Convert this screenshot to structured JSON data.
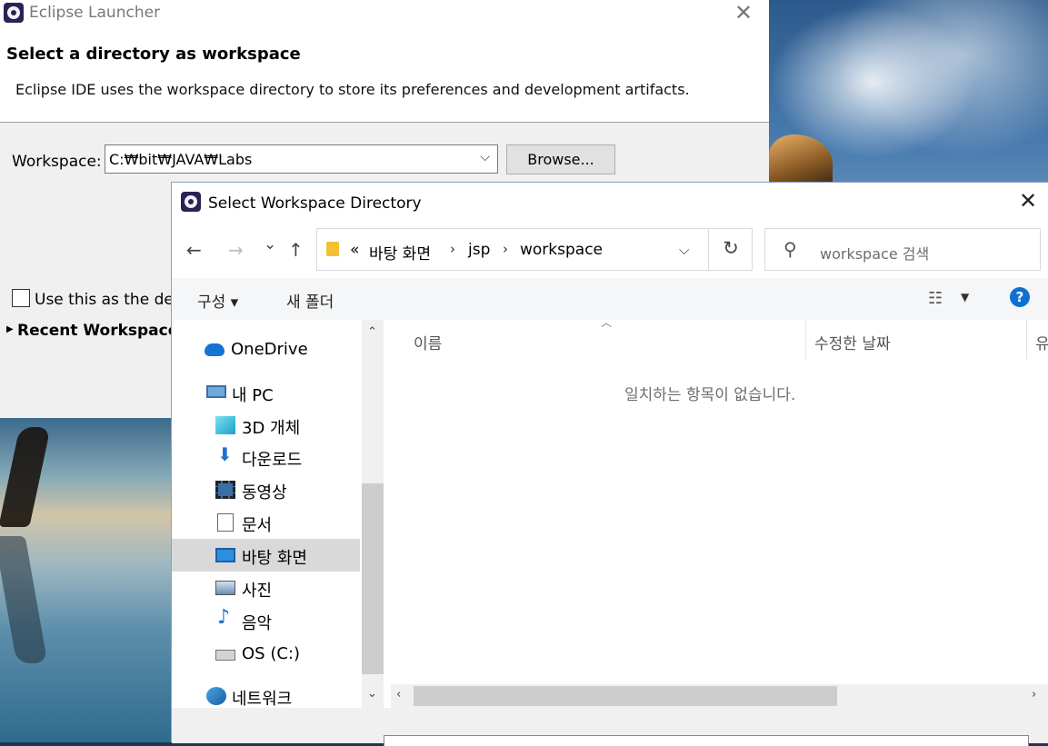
{
  "launcher": {
    "title": "Eclipse Launcher",
    "close_glyph": "✕",
    "heading": "Select a directory as workspace",
    "description": "Eclipse IDE uses the workspace directory to store its preferences and development artifacts.",
    "workspace_label": "Workspace:",
    "workspace_value": "C:₩bit₩JAVA₩Labs",
    "browse_label": "Browse...",
    "default_label": "Use this as the det",
    "recent_label": "Recent Workspaces"
  },
  "dialog": {
    "title": "Select Workspace Directory",
    "close_glyph": "✕",
    "nav": {
      "back": "←",
      "forward": "→",
      "history": "⌄",
      "up": "↑"
    },
    "address": {
      "overflow": "«",
      "crumbs": [
        "바탕 화면",
        "jsp",
        "workspace"
      ],
      "separator": "›"
    },
    "refresh_glyph": "↻",
    "search_placeholder": "workspace 검색",
    "toolbar": {
      "organize": "구성 ▾",
      "new_folder": "새 폴더",
      "help": "?"
    },
    "navpane": [
      {
        "label": "OneDrive",
        "icon": "cloud-icon"
      },
      {
        "label": "내 PC",
        "icon": "computer-icon"
      },
      {
        "label": "3D 개체",
        "icon": "cube-icon"
      },
      {
        "label": "다운로드",
        "icon": "download-icon"
      },
      {
        "label": "동영상",
        "icon": "video-icon"
      },
      {
        "label": "문서",
        "icon": "document-icon"
      },
      {
        "label": "바탕 화면",
        "icon": "desktop-icon",
        "selected": true
      },
      {
        "label": "사진",
        "icon": "picture-icon"
      },
      {
        "label": "음악",
        "icon": "music-icon"
      },
      {
        "label": "OS (C:)",
        "icon": "drive-icon"
      },
      {
        "label": "네트워크",
        "icon": "network-icon"
      }
    ],
    "columns": [
      "이름",
      "수정한 날짜",
      "유"
    ],
    "empty_message": "일치하는 항목이 없습니다."
  },
  "colors": {
    "accent": "#1070d0",
    "selected_bg": "#d9d9d9",
    "folder": "#f1c230",
    "eclipse": "#2c2255"
  }
}
